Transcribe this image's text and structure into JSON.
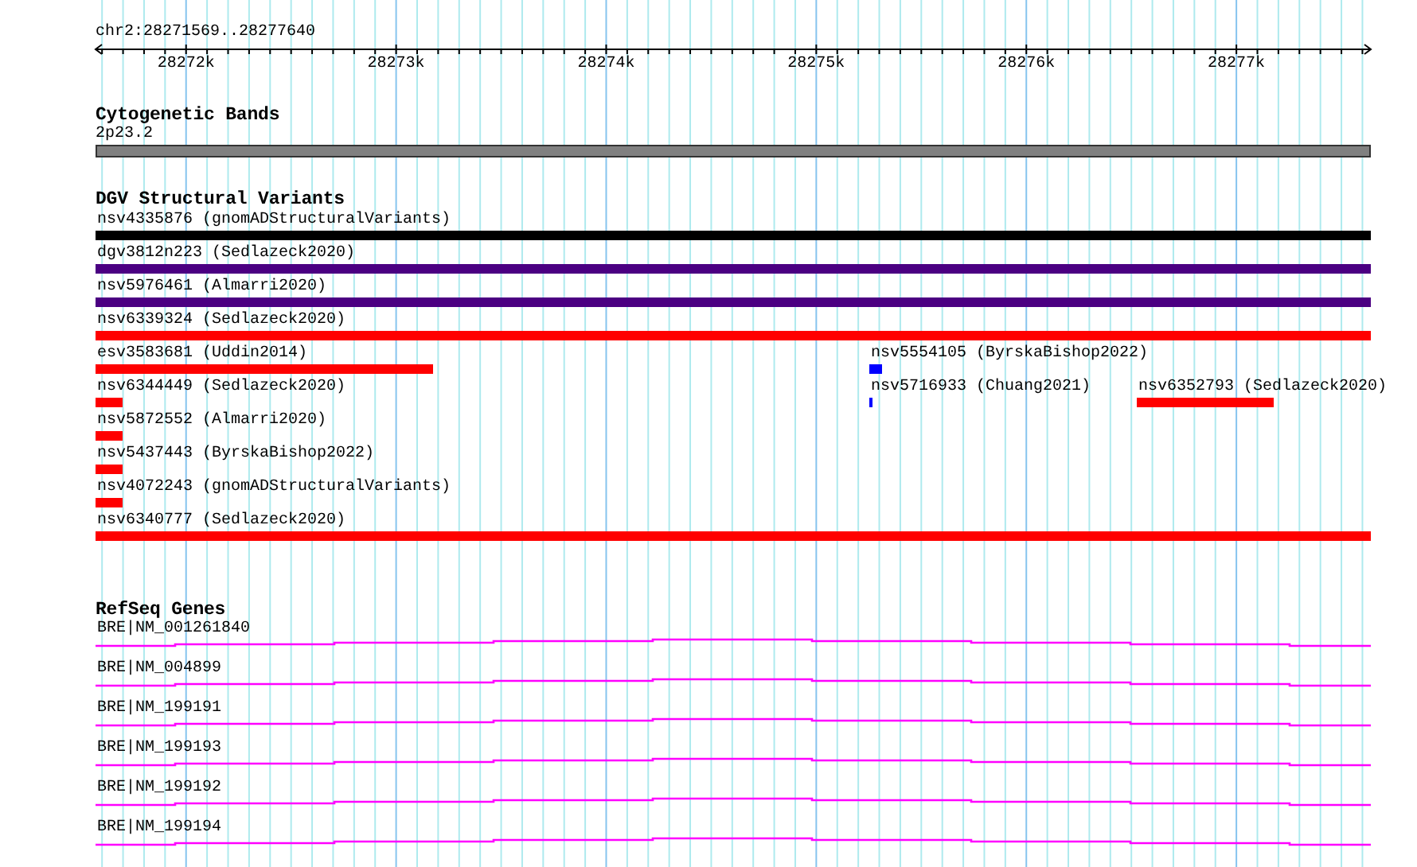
{
  "region": {
    "label": "chr2:28271569..28277640",
    "ticks": [
      "28272k",
      "28273k",
      "28274k",
      "28275k",
      "28276k",
      "28277k"
    ]
  },
  "tracks": [
    {
      "kind": "bands",
      "title": "Cytogenetic Bands",
      "features": [
        {
          "name": "2p23.2"
        }
      ]
    },
    {
      "kind": "variants",
      "title": "DGV Structural Variants",
      "features": [
        {
          "name": "nsv4335876 (gnomADStructuralVariants)",
          "color": "#000000"
        },
        {
          "name": "dgv3812n223 (Sedlazeck2020)",
          "color": "#4b0082"
        },
        {
          "name": "nsv5976461 (Almarri2020)",
          "color": "#4b0082"
        },
        {
          "name": "nsv6339324 (Sedlazeck2020)",
          "color": "#ff0000"
        },
        {
          "name": "esv3583681 (Uddin2014)",
          "color": "#ff0000"
        },
        {
          "name": "nsv5554105 (ByrskaBishop2022)",
          "color": "#0000ff"
        },
        {
          "name": "nsv6344449 (Sedlazeck2020)",
          "color": "#ff0000"
        },
        {
          "name": "nsv5716933 (Chuang2021)",
          "color": "#0000ff"
        },
        {
          "name": "nsv6352793 (Sedlazeck2020)",
          "color": "#ff0000"
        },
        {
          "name": "nsv5872552 (Almarri2020)",
          "color": "#ff0000"
        },
        {
          "name": "nsv5437443 (ByrskaBishop2022)",
          "color": "#ff0000"
        },
        {
          "name": "nsv4072243 (gnomADStructuralVariants)",
          "color": "#ff0000"
        },
        {
          "name": "nsv6340777 (Sedlazeck2020)",
          "color": "#ff0000"
        }
      ]
    },
    {
      "kind": "genes",
      "title": "RefSeq Genes",
      "features": [
        {
          "name": "BRE|NM_001261840"
        },
        {
          "name": "BRE|NM_004899"
        },
        {
          "name": "BRE|NM_199191"
        },
        {
          "name": "BRE|NM_199193"
        },
        {
          "name": "BRE|NM_199192"
        },
        {
          "name": "BRE|NM_199194"
        }
      ]
    }
  ]
}
